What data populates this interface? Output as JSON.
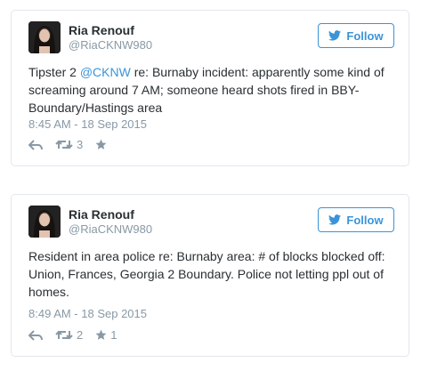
{
  "tweets": [
    {
      "name": "Ria Renouf",
      "handle": "@RiaCKNW980",
      "follow_label": "Follow",
      "text_before": "Tipster 2 ",
      "mention": "@CKNW",
      "text_after": " re: Burnaby incident: apparently some kind of screaming around 7 AM; someone heard shots fired in BBY-Boundary/Hastings area",
      "timestamp": "8:45 AM - 18 Sep 2015",
      "retweets": "3",
      "likes": ""
    },
    {
      "name": "Ria Renouf",
      "handle": "@RiaCKNW980",
      "follow_label": "Follow",
      "text": "Resident in area police re: Burnaby area: # of blocks blocked off: Union, Frances, Georgia 2 Boundary. Police not letting ppl out of homes.",
      "timestamp": "8:49 AM - 18 Sep 2015",
      "retweets": "2",
      "likes": "1"
    }
  ],
  "colors": {
    "accent": "#3b94d9",
    "muted": "#8899a6",
    "text": "#292f33",
    "border": "#e1e8ed"
  },
  "icons": [
    "reply-icon",
    "retweet-icon",
    "like-star-icon",
    "twitter-bird-icon"
  ]
}
